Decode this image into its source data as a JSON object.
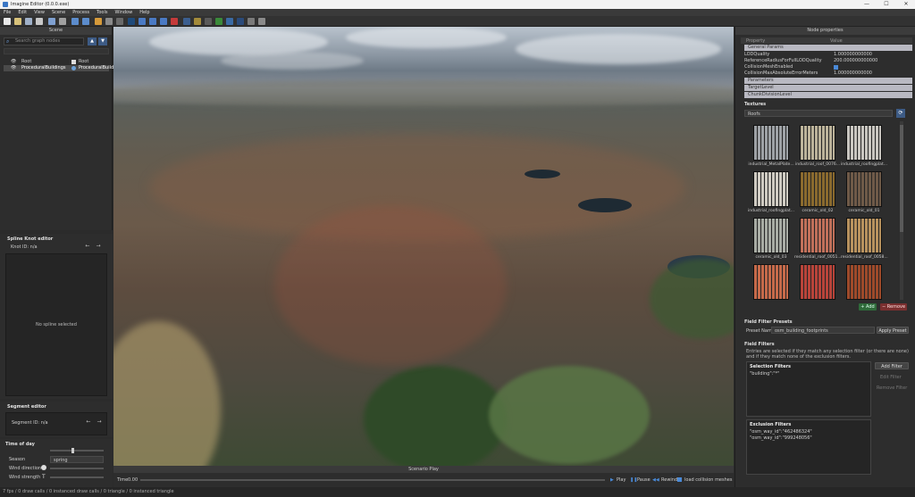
{
  "window": {
    "title": "Imagine Editor (0.0.0.exe)",
    "minimize": "—",
    "maximize": "☐",
    "close": "✕"
  },
  "menu": [
    "File",
    "Edit",
    "View",
    "Scene",
    "Process",
    "Tools",
    "Window",
    "Help"
  ],
  "scene_panel": {
    "title": "Scene",
    "search_placeholder": "Search graph nodes",
    "tree": [
      {
        "label": "Root",
        "type": "Root"
      },
      {
        "label": "ProceduralBuildings",
        "type": "ProceduralBuildings"
      }
    ]
  },
  "spline_editor": {
    "title": "Spline Knot editor",
    "knot_id": "Knot ID: n/a",
    "empty": "No spline selected"
  },
  "segment_editor": {
    "title": "Segment editor",
    "segment_id": "Segment ID: n/a"
  },
  "time_of_day": {
    "title": "Time of day",
    "season_label": "Season",
    "season_value": "spring",
    "wind_direction_label": "Wind direction",
    "wind_strength_label": "Wind strength"
  },
  "viewport": {
    "header": "Scenario Play",
    "time_label": "Time",
    "time_value": "0.00",
    "play": "Play",
    "pause": "Pause",
    "rewind": "Rewind",
    "load_collision": "load collision meshes"
  },
  "status": "7 fps / 0 draw calls / 0 instanced draw calls / 0 triangle / 0 instanced triangle",
  "node_properties": {
    "title": "Node properties",
    "col_property": "Property",
    "col_value": "Value",
    "group_general": "General Params",
    "rows": [
      {
        "name": "LODQuality",
        "value": "1.000000000000"
      },
      {
        "name": "ReferenceRadiusForFullLODQuality",
        "value": "200.000000000000"
      },
      {
        "name": "CollisionMeshEnabled",
        "value": ""
      },
      {
        "name": "CollisionMaxAbsoluteErrorMeters",
        "value": "1.000000000000"
      }
    ],
    "groups": [
      "Parameters",
      "TargetLevel",
      "ChunkDivisionLevel"
    ]
  },
  "textures": {
    "title": "Textures",
    "filter_value": "Roofs",
    "items": [
      {
        "label": "industrial_MetalPlate...",
        "color": "#9ea2a6"
      },
      {
        "label": "industrial_roof_0076...",
        "color": "#bcb39a"
      },
      {
        "label": "industrial_roofingplat...",
        "color": "#c9c6c0"
      },
      {
        "label": "industrial_roofingplat...",
        "color": "#cfcbc2"
      },
      {
        "label": "ceramic_old_02",
        "color": "#8a6a2e"
      },
      {
        "label": "ceramic_old_01",
        "color": "#6f5a48"
      },
      {
        "label": "ceramic_old_03",
        "color": "#a8aca4"
      },
      {
        "label": "residential_roof_0051...",
        "color": "#c0705a"
      },
      {
        "label": "residential_roof_0058...",
        "color": "#b8925e"
      },
      {
        "label": "",
        "color": "#c66a4a"
      },
      {
        "label": "",
        "color": "#b8443a"
      },
      {
        "label": "",
        "color": "#9e4a2a"
      }
    ],
    "add": "Add",
    "remove": "Remove"
  },
  "field_filter_presets": {
    "title": "Field Filter Presets",
    "preset_label": "Preset Name",
    "preset_value": "osm_building_footprints",
    "apply": "Apply Preset"
  },
  "field_filters": {
    "title": "Field Filters",
    "description": "Entries are selected if they match any selection filter (or there are none) and if they match none of the exclusion filters.",
    "selection_title": "Selection Filters",
    "selection_items": [
      "\"building\":\"*\""
    ],
    "add_filter": "Add Filter",
    "edit_filter": "Edit Filter",
    "remove_filter": "Remove Filter",
    "exclusion_title": "Exclusion Filters",
    "exclusion_items": [
      "\"osm_way_id\":\"462486324\"",
      "\"osm_way_id\":\"999248056\""
    ]
  }
}
